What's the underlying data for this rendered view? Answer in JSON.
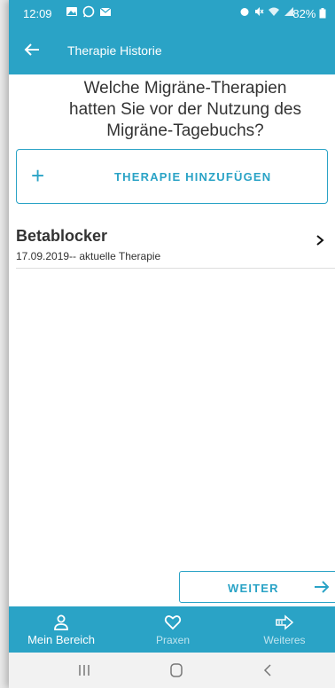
{
  "status_bar": {
    "time": "12:09",
    "battery": "82%",
    "left_icons": [
      "image-icon",
      "whatsapp-icon",
      "mail-icon"
    ],
    "right_icons": [
      "alarm-icon",
      "mute-icon",
      "wifi-icon",
      "signal-icon",
      "battery-icon"
    ]
  },
  "app_bar": {
    "title": "Therapie Historie",
    "back_icon": "arrow-left-icon"
  },
  "colors": {
    "accent": "#2aa3c6",
    "text": "#333333",
    "divider": "#dddddd"
  },
  "question": {
    "line1": "Welche Migräne-Therapien",
    "line2": "hatten Sie vor der Nutzung des",
    "line3": "Migräne-Tagebuchs?"
  },
  "add_button": {
    "icon": "+",
    "label": "THERAPIE HINZUFÜGEN"
  },
  "therapies": [
    {
      "name": "Betablocker",
      "dates": "17.09.2019-- aktuelle Therapie"
    }
  ],
  "weiter_button": {
    "label": "WEITER"
  },
  "bottom_nav": {
    "items": [
      {
        "label": "Mein Bereich",
        "icon": "person-icon",
        "active": true
      },
      {
        "label": "Praxen",
        "icon": "heart-icon",
        "active": false
      },
      {
        "label": "Weiteres",
        "icon": "arrow-right-icon",
        "active": false
      }
    ]
  },
  "system_nav": [
    "recent-apps-icon",
    "home-icon",
    "back-icon"
  ]
}
